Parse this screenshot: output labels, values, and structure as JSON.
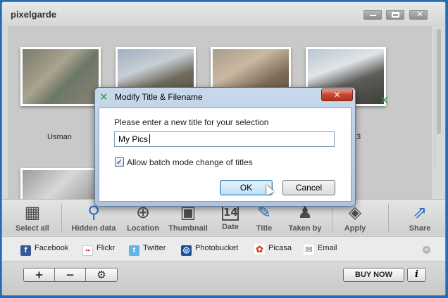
{
  "app": {
    "title": "pixelgarde"
  },
  "gallery": {
    "photos": [
      {
        "caption": "Usman"
      },
      {
        "caption": ""
      },
      {
        "caption": ""
      },
      {
        "caption": "3"
      }
    ]
  },
  "toolbar": {
    "items": [
      {
        "label": "Select all",
        "icon": "grid-icon"
      },
      {
        "label": "Hidden data",
        "icon": "magnifier-icon"
      },
      {
        "label": "Location",
        "icon": "location-icon"
      },
      {
        "label": "Thumbnail",
        "icon": "thumbnail-icon"
      },
      {
        "label": "Date",
        "icon": "calendar-icon",
        "glyph": "14"
      },
      {
        "label": "Title",
        "icon": "pencil-icon"
      },
      {
        "label": "Taken by",
        "icon": "person-icon"
      },
      {
        "label": "Apply",
        "icon": "apply-icon"
      },
      {
        "label": "Share",
        "icon": "share-icon"
      }
    ]
  },
  "social": {
    "services": [
      {
        "label": "Facebook",
        "color": "#3b5998",
        "glyph": "f"
      },
      {
        "label": "Flickr",
        "color": "#ffffff",
        "glyph": "••"
      },
      {
        "label": "Twitter",
        "color": "#5fb7e8",
        "glyph": "t"
      },
      {
        "label": "Photobucket",
        "color": "#1f4f9c",
        "glyph": "◎"
      },
      {
        "label": "Picasa",
        "color": "#ffffff",
        "glyph": "✿"
      },
      {
        "label": "Email",
        "color": "#ffffff",
        "glyph": "✉"
      }
    ]
  },
  "bottombar": {
    "add": "+",
    "remove": "−",
    "settings": "⚙",
    "buy_now": "BUY NOW",
    "info": "i"
  },
  "dialog": {
    "title": "Modify Title & Filename",
    "close": "✕",
    "prompt": "Please enter a new title for your selection",
    "input_value": "My Pics",
    "checkbox_label": "Allow batch mode change of titles",
    "checkbox_checked": true,
    "ok_label": "OK",
    "cancel_label": "Cancel"
  }
}
